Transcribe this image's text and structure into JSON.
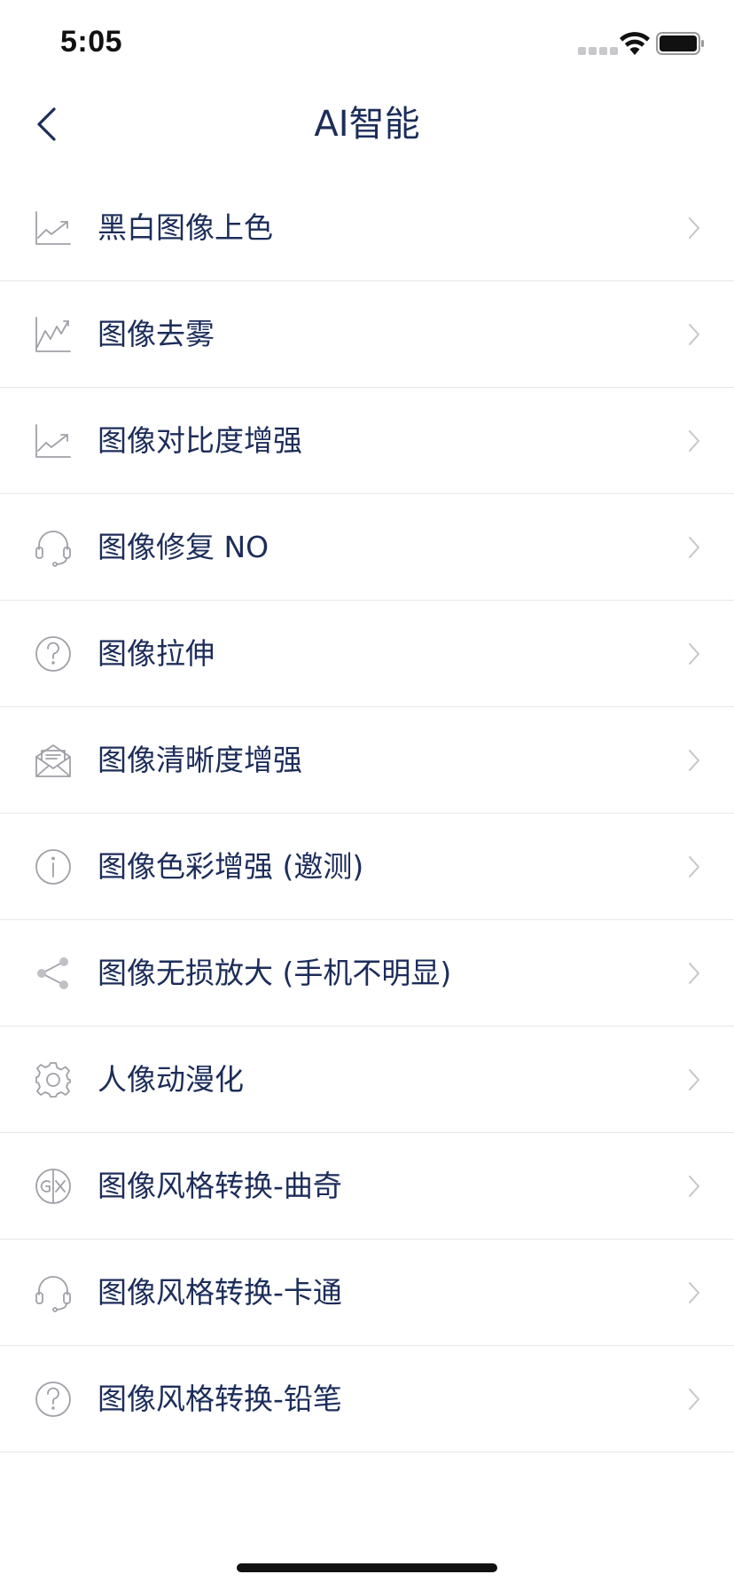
{
  "status_bar": {
    "time": "5:05"
  },
  "nav": {
    "title": "AI智能",
    "back_icon": "chevron-left-icon"
  },
  "list": {
    "items": [
      {
        "label": "黑白图像上色",
        "icon": "trending-up-icon"
      },
      {
        "label": "图像去雾",
        "icon": "line-chart-icon"
      },
      {
        "label": "图像对比度增强",
        "icon": "trending-up-icon"
      },
      {
        "label": "图像修复 NO",
        "icon": "headset-icon"
      },
      {
        "label": "图像拉伸",
        "icon": "question-circle-icon"
      },
      {
        "label": "图像清晰度增强",
        "icon": "mail-open-icon"
      },
      {
        "label": "图像色彩增强 (邀测)",
        "icon": "info-circle-icon"
      },
      {
        "label": "图像无损放大 (手机不明显)",
        "icon": "share-icon"
      },
      {
        "label": "人像动漫化",
        "icon": "gear-icon"
      },
      {
        "label": "图像风格转换-曲奇",
        "icon": "translate-icon"
      },
      {
        "label": "图像风格转换-卡通",
        "icon": "headset-icon"
      },
      {
        "label": "图像风格转换-铅笔",
        "icon": "question-circle-icon"
      }
    ]
  },
  "colors": {
    "text_primary": "#1c2d5a",
    "icon_gray": "#a0a0a8",
    "chevron_gray": "#c5c5cb",
    "divider": "#e8e8ec",
    "background": "#ffffff"
  }
}
